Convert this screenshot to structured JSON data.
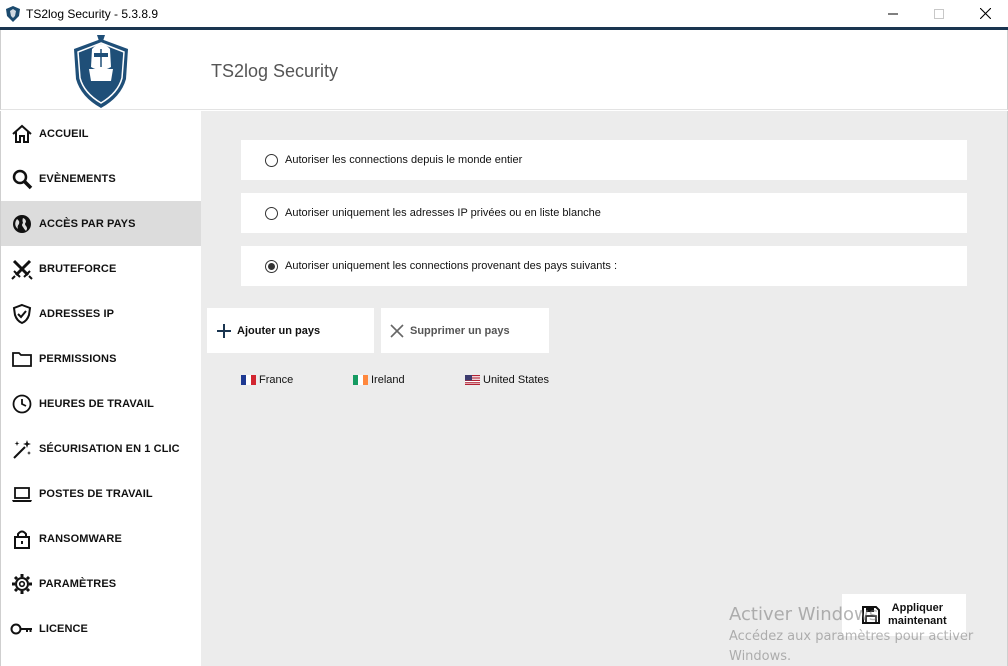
{
  "window": {
    "title": "TS2log Security - 5.3.8.9",
    "minimize": "—",
    "maximize": "☐",
    "close": "✕"
  },
  "header": {
    "app_name": "TS2log Security"
  },
  "sidebar": {
    "items": [
      {
        "label": "ACCUEIL",
        "icon": "home-icon"
      },
      {
        "label": "EVÈNEMENTS",
        "icon": "search-icon"
      },
      {
        "label": "ACCÈS PAR PAYS",
        "icon": "globe-icon",
        "active": true
      },
      {
        "label": "BRUTEFORCE",
        "icon": "crossed-swords-icon"
      },
      {
        "label": "ADRESSES IP",
        "icon": "shield-check-icon"
      },
      {
        "label": "PERMISSIONS",
        "icon": "folder-icon"
      },
      {
        "label": "HEURES DE TRAVAIL",
        "icon": "clock-icon"
      },
      {
        "label": "SÉCURISATION EN 1 CLIC",
        "icon": "magic-wand-icon"
      },
      {
        "label": "POSTES DE TRAVAIL",
        "icon": "laptop-icon"
      },
      {
        "label": "RANSOMWARE",
        "icon": "lock-icon"
      },
      {
        "label": "PARAMÈTRES",
        "icon": "gear-icon"
      },
      {
        "label": "LICENCE",
        "icon": "key-icon"
      }
    ]
  },
  "main": {
    "options": [
      {
        "label": "Autoriser les connections depuis le monde entier",
        "selected": false
      },
      {
        "label": "Autoriser uniquement les adresses IP privées ou en liste blanche",
        "selected": false
      },
      {
        "label": "Autoriser uniquement les connections provenant des pays suivants :",
        "selected": true
      }
    ],
    "add_button": "Ajouter un pays",
    "remove_button": "Supprimer un pays",
    "countries": [
      {
        "name": "France",
        "flag": "flag-france-icon"
      },
      {
        "name": "Ireland",
        "flag": "flag-ireland-icon"
      },
      {
        "name": "United States",
        "flag": "flag-us-icon"
      }
    ],
    "apply_button_line1": "Appliquer",
    "apply_button_line2": "maintenant"
  },
  "watermark": {
    "title": "Activer Windows",
    "subtitle": "Accédez aux paramètres pour activer Windows."
  },
  "colors": {
    "accent": "#1a3550",
    "active_nav": "#dcdcdc",
    "content_bg": "#ececec"
  }
}
